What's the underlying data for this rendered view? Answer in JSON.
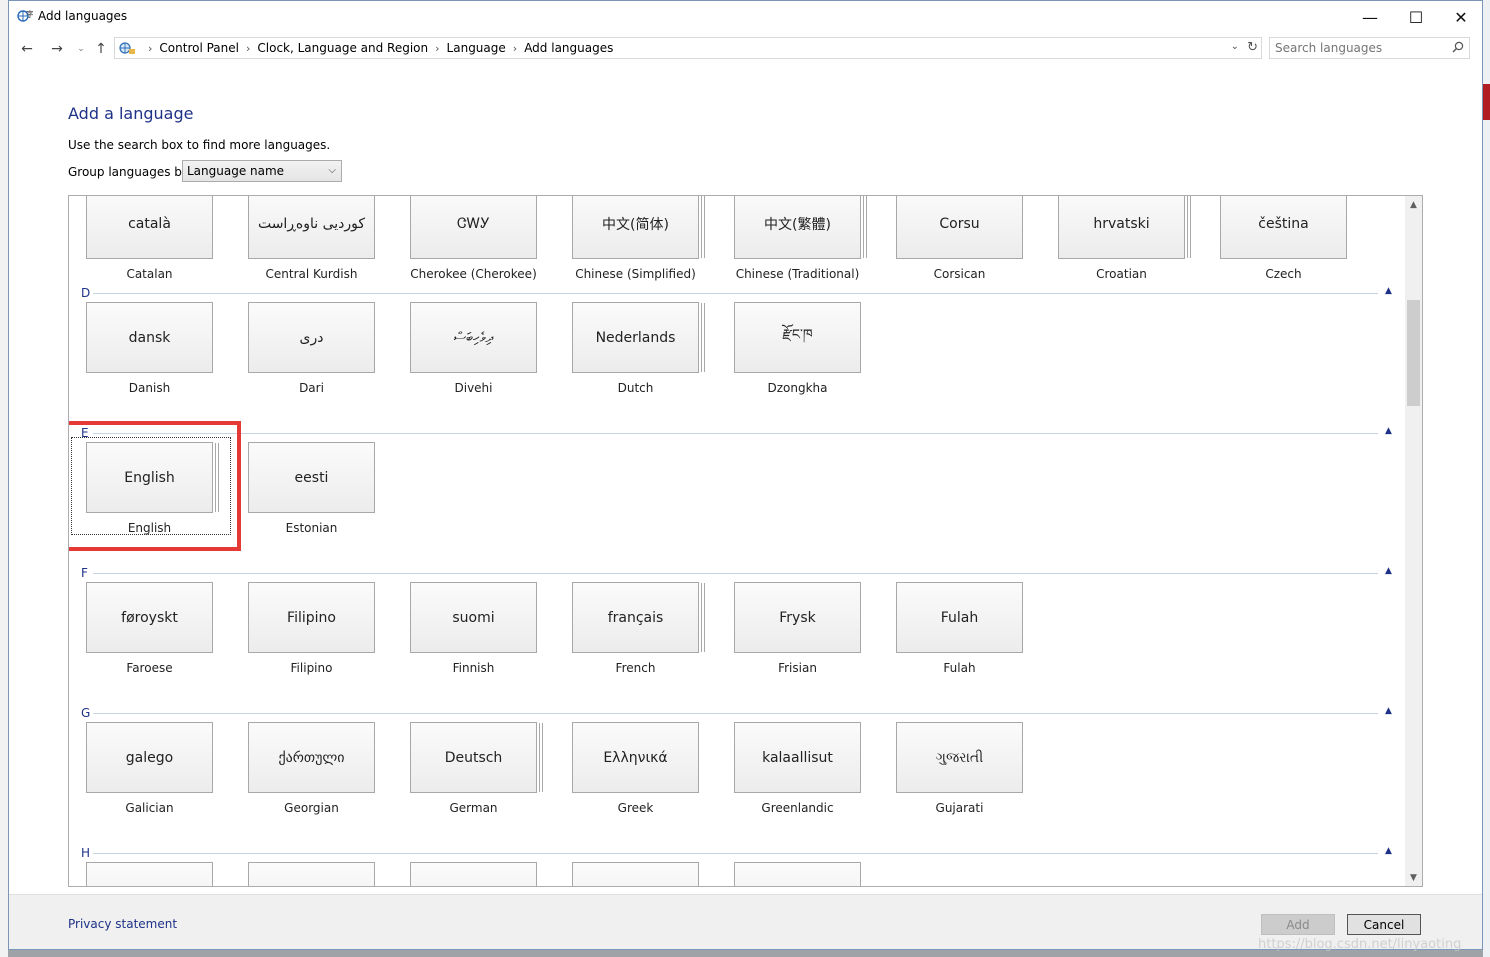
{
  "window": {
    "title": "Add languages",
    "minimize": "—",
    "maximize": "☐",
    "close": "✕"
  },
  "nav": {
    "back": "←",
    "forward": "→",
    "recent": "⌄",
    "up": "↑",
    "breadcrumbs": [
      "Control Panel",
      "Clock, Language and Region",
      "Language",
      "Add languages"
    ],
    "refresh": "↻",
    "dropdown": "⌄"
  },
  "search": {
    "placeholder": "Search languages"
  },
  "main": {
    "heading": "Add a language",
    "hint": "Use the search box to find more languages.",
    "group_label": "Group languages by:",
    "group_value": "Language name"
  },
  "groups": [
    {
      "letter": "",
      "tiles": [
        {
          "native": "català",
          "name": "Catalan",
          "multi": false
        },
        {
          "native": "کوردیی ناوەڕاست",
          "name": "Central Kurdish",
          "multi": false
        },
        {
          "native": "ᏣᎳᎩ",
          "name": "Cherokee (Cherokee)",
          "multi": false
        },
        {
          "native": "中文(简体)",
          "name": "Chinese (Simplified)",
          "multi": true
        },
        {
          "native": "中文(繁體)",
          "name": "Chinese (Traditional)",
          "multi": true
        },
        {
          "native": "Corsu",
          "name": "Corsican",
          "multi": false
        },
        {
          "native": "hrvatski",
          "name": "Croatian",
          "multi": true
        },
        {
          "native": "čeština",
          "name": "Czech",
          "multi": false
        }
      ]
    },
    {
      "letter": "D",
      "tiles": [
        {
          "native": "dansk",
          "name": "Danish",
          "multi": false
        },
        {
          "native": "دری",
          "name": "Dari",
          "multi": false
        },
        {
          "native": "ދިވެހިބަސް",
          "name": "Divehi",
          "multi": false
        },
        {
          "native": "Nederlands",
          "name": "Dutch",
          "multi": true
        },
        {
          "native": "རྫོང་ཁ",
          "name": "Dzongkha",
          "multi": false
        }
      ]
    },
    {
      "letter": "E",
      "tiles": [
        {
          "native": "English",
          "name": "English",
          "multi": true,
          "selected": true
        },
        {
          "native": "eesti",
          "name": "Estonian",
          "multi": false
        }
      ]
    },
    {
      "letter": "F",
      "tiles": [
        {
          "native": "føroyskt",
          "name": "Faroese",
          "multi": false
        },
        {
          "native": "Filipino",
          "name": "Filipino",
          "multi": false
        },
        {
          "native": "suomi",
          "name": "Finnish",
          "multi": false
        },
        {
          "native": "français",
          "name": "French",
          "multi": true
        },
        {
          "native": "Frysk",
          "name": "Frisian",
          "multi": false
        },
        {
          "native": "Fulah",
          "name": "Fulah",
          "multi": false
        }
      ]
    },
    {
      "letter": "G",
      "tiles": [
        {
          "native": "galego",
          "name": "Galician",
          "multi": false
        },
        {
          "native": "ქართული",
          "name": "Georgian",
          "multi": false
        },
        {
          "native": "Deutsch",
          "name": "German",
          "multi": true
        },
        {
          "native": "Ελληνικά",
          "name": "Greek",
          "multi": false
        },
        {
          "native": "kalaallisut",
          "name": "Greenlandic",
          "multi": false
        },
        {
          "native": "ગુજરાતી",
          "name": "Gujarati",
          "multi": false
        }
      ]
    },
    {
      "letter": "H",
      "tiles": [
        {
          "native": "",
          "name": "",
          "multi": false
        },
        {
          "native": "",
          "name": "",
          "multi": false
        },
        {
          "native": "",
          "name": "",
          "multi": false
        },
        {
          "native": "",
          "name": "",
          "multi": false
        },
        {
          "native": "",
          "name": "",
          "multi": false
        }
      ]
    }
  ],
  "footer": {
    "privacy": "Privacy statement",
    "add": "Add",
    "cancel": "Cancel"
  },
  "watermark": "https://blog.csdn.net/linyaoting",
  "colors": {
    "link": "#1e3287",
    "highlight": "#e53935"
  }
}
